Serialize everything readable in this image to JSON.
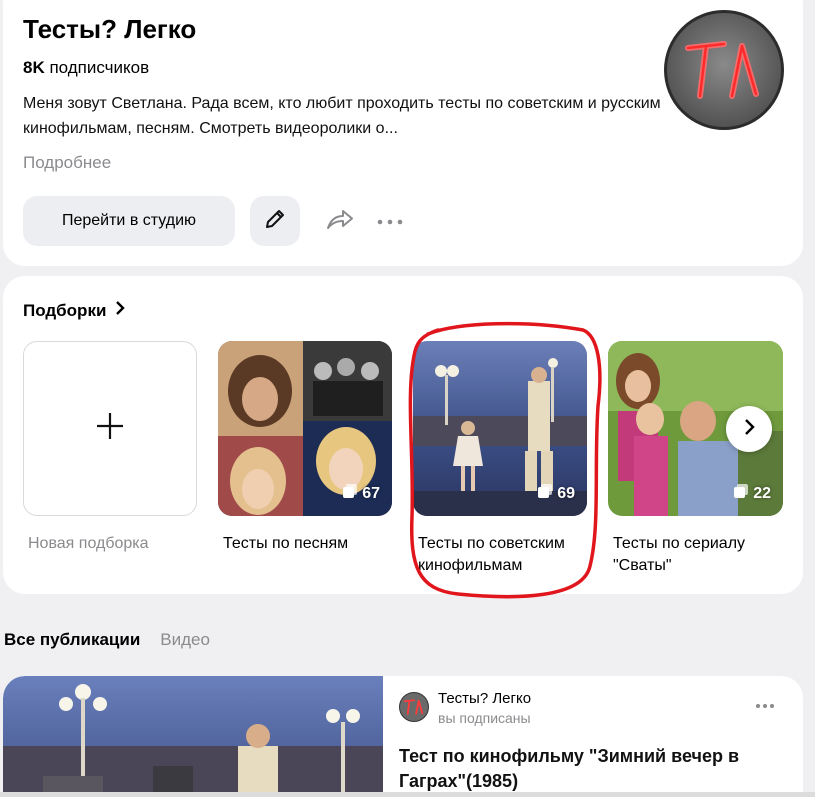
{
  "channel": {
    "title": "Тесты? Легко",
    "subscribers_count": "8K",
    "subscribers_label": "подписчиков",
    "description": "Меня зовут Светлана. Рада всем, кто любит проходить тесты по советским и русским кинофильмам, песням. Смотреть видеоролики о...",
    "more_label": "Подробнее",
    "studio_button": "Перейти в студию",
    "edit_icon": "pencil-icon",
    "share_icon": "share-arrow-icon",
    "more_icon": "more-dots-icon",
    "avatar_text": "ТЛ",
    "accent_color": "#ff4d4d"
  },
  "collections": {
    "title": "Подборки",
    "new_label": "Новая подборка",
    "items": [
      {
        "label": "Тесты по песням",
        "count": "67"
      },
      {
        "label": "Тесты по советским кинофильмам",
        "count": "69"
      },
      {
        "label": "Тесты по сериалу \"Сваты\"",
        "count": "22"
      }
    ],
    "highlight_color": "#e0161c"
  },
  "tabs": [
    {
      "label": "Все публикации",
      "active": true
    },
    {
      "label": "Видео",
      "active": false
    }
  ],
  "publication": {
    "author": "Тесты? Легко",
    "status": "вы подписаны",
    "title": "Тест по кинофильму \"Зимний вечер в Гаграх\"(1985)"
  }
}
